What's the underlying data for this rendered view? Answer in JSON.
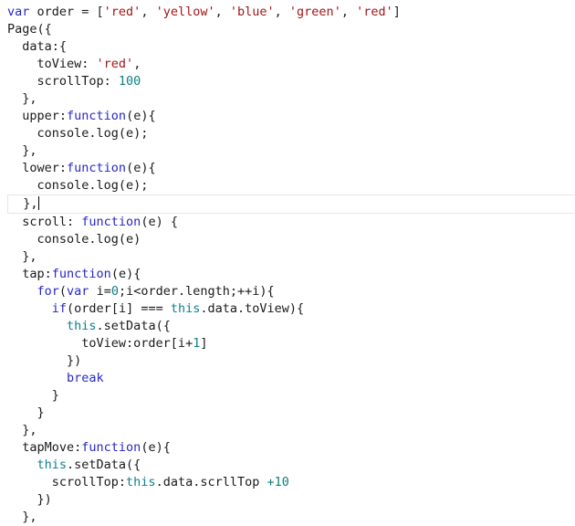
{
  "editor": {
    "language": "JavaScript",
    "cursor_line_index": 10,
    "colors": {
      "background": "#ffffff",
      "foreground": "#1a1a1a",
      "keyword": "#2727c8",
      "string": "#a31515",
      "number": "#0f8080",
      "this_keyword": "#0d7f91",
      "active_line_border": "#e6e6e6",
      "caret": "#000000"
    },
    "lines": [
      {
        "index": 0,
        "text": "var order = ['red', 'yellow', 'blue', 'green', 'red']",
        "tokens": [
          {
            "t": "var",
            "k": "kw"
          },
          {
            "t": " order = [",
            "k": "plain"
          },
          {
            "t": "'red'",
            "k": "str"
          },
          {
            "t": ", ",
            "k": "plain"
          },
          {
            "t": "'yellow'",
            "k": "str"
          },
          {
            "t": ", ",
            "k": "plain"
          },
          {
            "t": "'blue'",
            "k": "str"
          },
          {
            "t": ", ",
            "k": "plain"
          },
          {
            "t": "'green'",
            "k": "str"
          },
          {
            "t": ", ",
            "k": "plain"
          },
          {
            "t": "'red'",
            "k": "str"
          },
          {
            "t": "]",
            "k": "plain"
          }
        ]
      },
      {
        "index": 1,
        "text": "Page({",
        "tokens": [
          {
            "t": "Page({",
            "k": "plain"
          }
        ]
      },
      {
        "index": 2,
        "text": "  data:{",
        "tokens": [
          {
            "t": "  data:{",
            "k": "plain"
          }
        ]
      },
      {
        "index": 3,
        "text": "    toView: 'red',",
        "tokens": [
          {
            "t": "    toView: ",
            "k": "plain"
          },
          {
            "t": "'red'",
            "k": "str"
          },
          {
            "t": ",",
            "k": "plain"
          }
        ]
      },
      {
        "index": 4,
        "text": "    scrollTop: 100",
        "tokens": [
          {
            "t": "    scrollTop: ",
            "k": "plain"
          },
          {
            "t": "100",
            "k": "num"
          }
        ]
      },
      {
        "index": 5,
        "text": "  },",
        "tokens": [
          {
            "t": "  },",
            "k": "plain"
          }
        ]
      },
      {
        "index": 6,
        "text": "  upper:function(e){",
        "tokens": [
          {
            "t": "  upper:",
            "k": "plain"
          },
          {
            "t": "function",
            "k": "kw"
          },
          {
            "t": "(e){",
            "k": "plain"
          }
        ]
      },
      {
        "index": 7,
        "text": "    console.log(e);",
        "tokens": [
          {
            "t": "    console.log(e);",
            "k": "plain"
          }
        ]
      },
      {
        "index": 8,
        "text": "  },",
        "tokens": [
          {
            "t": "  },",
            "k": "plain"
          }
        ]
      },
      {
        "index": 9,
        "text": "  lower:function(e){",
        "tokens": [
          {
            "t": "  lower:",
            "k": "plain"
          },
          {
            "t": "function",
            "k": "kw"
          },
          {
            "t": "(e){",
            "k": "plain"
          }
        ]
      },
      {
        "index": 10,
        "text": "    console.log(e);",
        "tokens": [
          {
            "t": "    console.log(e);",
            "k": "plain"
          }
        ]
      },
      {
        "index": 11,
        "text": "  },",
        "active": true,
        "tokens": [
          {
            "t": "  },",
            "k": "plain"
          }
        ]
      },
      {
        "index": 12,
        "text": "  scroll: function(e) {",
        "tokens": [
          {
            "t": "  scroll: ",
            "k": "plain"
          },
          {
            "t": "function",
            "k": "kw"
          },
          {
            "t": "(e) {",
            "k": "plain"
          }
        ]
      },
      {
        "index": 13,
        "text": "    console.log(e)",
        "tokens": [
          {
            "t": "    console.log(e)",
            "k": "plain"
          }
        ]
      },
      {
        "index": 14,
        "text": "  },",
        "tokens": [
          {
            "t": "  },",
            "k": "plain"
          }
        ]
      },
      {
        "index": 15,
        "text": "  tap:function(e){",
        "tokens": [
          {
            "t": "  tap:",
            "k": "plain"
          },
          {
            "t": "function",
            "k": "kw"
          },
          {
            "t": "(e){",
            "k": "plain"
          }
        ]
      },
      {
        "index": 16,
        "text": "    for(var i=0;i<order.length;++i){",
        "tokens": [
          {
            "t": "    ",
            "k": "plain"
          },
          {
            "t": "for",
            "k": "kw"
          },
          {
            "t": "(",
            "k": "plain"
          },
          {
            "t": "var",
            "k": "kw"
          },
          {
            "t": " i=",
            "k": "plain"
          },
          {
            "t": "0",
            "k": "num"
          },
          {
            "t": ";i<order.length;++i){",
            "k": "plain"
          }
        ]
      },
      {
        "index": 17,
        "text": "      if(order[i] === this.data.toView){",
        "tokens": [
          {
            "t": "      ",
            "k": "plain"
          },
          {
            "t": "if",
            "k": "kw"
          },
          {
            "t": "(order[i] === ",
            "k": "plain"
          },
          {
            "t": "this",
            "k": "this"
          },
          {
            "t": ".data.toView){",
            "k": "plain"
          }
        ]
      },
      {
        "index": 18,
        "text": "        this.setData({",
        "tokens": [
          {
            "t": "        ",
            "k": "plain"
          },
          {
            "t": "this",
            "k": "this"
          },
          {
            "t": ".setData({",
            "k": "plain"
          }
        ]
      },
      {
        "index": 19,
        "text": "          toView:order[i+1]",
        "tokens": [
          {
            "t": "          toView:order[i+",
            "k": "plain"
          },
          {
            "t": "1",
            "k": "num"
          },
          {
            "t": "]",
            "k": "plain"
          }
        ]
      },
      {
        "index": 20,
        "text": "        })",
        "tokens": [
          {
            "t": "        })",
            "k": "plain"
          }
        ]
      },
      {
        "index": 21,
        "text": "        break",
        "tokens": [
          {
            "t": "        ",
            "k": "plain"
          },
          {
            "t": "break",
            "k": "kw"
          }
        ]
      },
      {
        "index": 22,
        "text": "      }",
        "tokens": [
          {
            "t": "      }",
            "k": "plain"
          }
        ]
      },
      {
        "index": 23,
        "text": "    }",
        "tokens": [
          {
            "t": "    }",
            "k": "plain"
          }
        ]
      },
      {
        "index": 24,
        "text": "  },",
        "tokens": [
          {
            "t": "  },",
            "k": "plain"
          }
        ]
      },
      {
        "index": 25,
        "text": "  tapMove:function(e){",
        "tokens": [
          {
            "t": "  tapMove:",
            "k": "plain"
          },
          {
            "t": "function",
            "k": "kw"
          },
          {
            "t": "(e){",
            "k": "plain"
          }
        ]
      },
      {
        "index": 26,
        "text": "    this.setData({",
        "tokens": [
          {
            "t": "    ",
            "k": "plain"
          },
          {
            "t": "this",
            "k": "this"
          },
          {
            "t": ".setData({",
            "k": "plain"
          }
        ]
      },
      {
        "index": 27,
        "text": "      scrollTop:this.data.scrllTop +10",
        "tokens": [
          {
            "t": "      scrollTop:",
            "k": "plain"
          },
          {
            "t": "this",
            "k": "this"
          },
          {
            "t": ".data.scrllTop ",
            "k": "plain"
          },
          {
            "t": "+10",
            "k": "num"
          }
        ]
      },
      {
        "index": 28,
        "text": "    })",
        "tokens": [
          {
            "t": "    })",
            "k": "plain"
          }
        ]
      },
      {
        "index": 29,
        "text": "  },",
        "tokens": [
          {
            "t": "  },",
            "k": "plain"
          }
        ]
      }
    ]
  }
}
